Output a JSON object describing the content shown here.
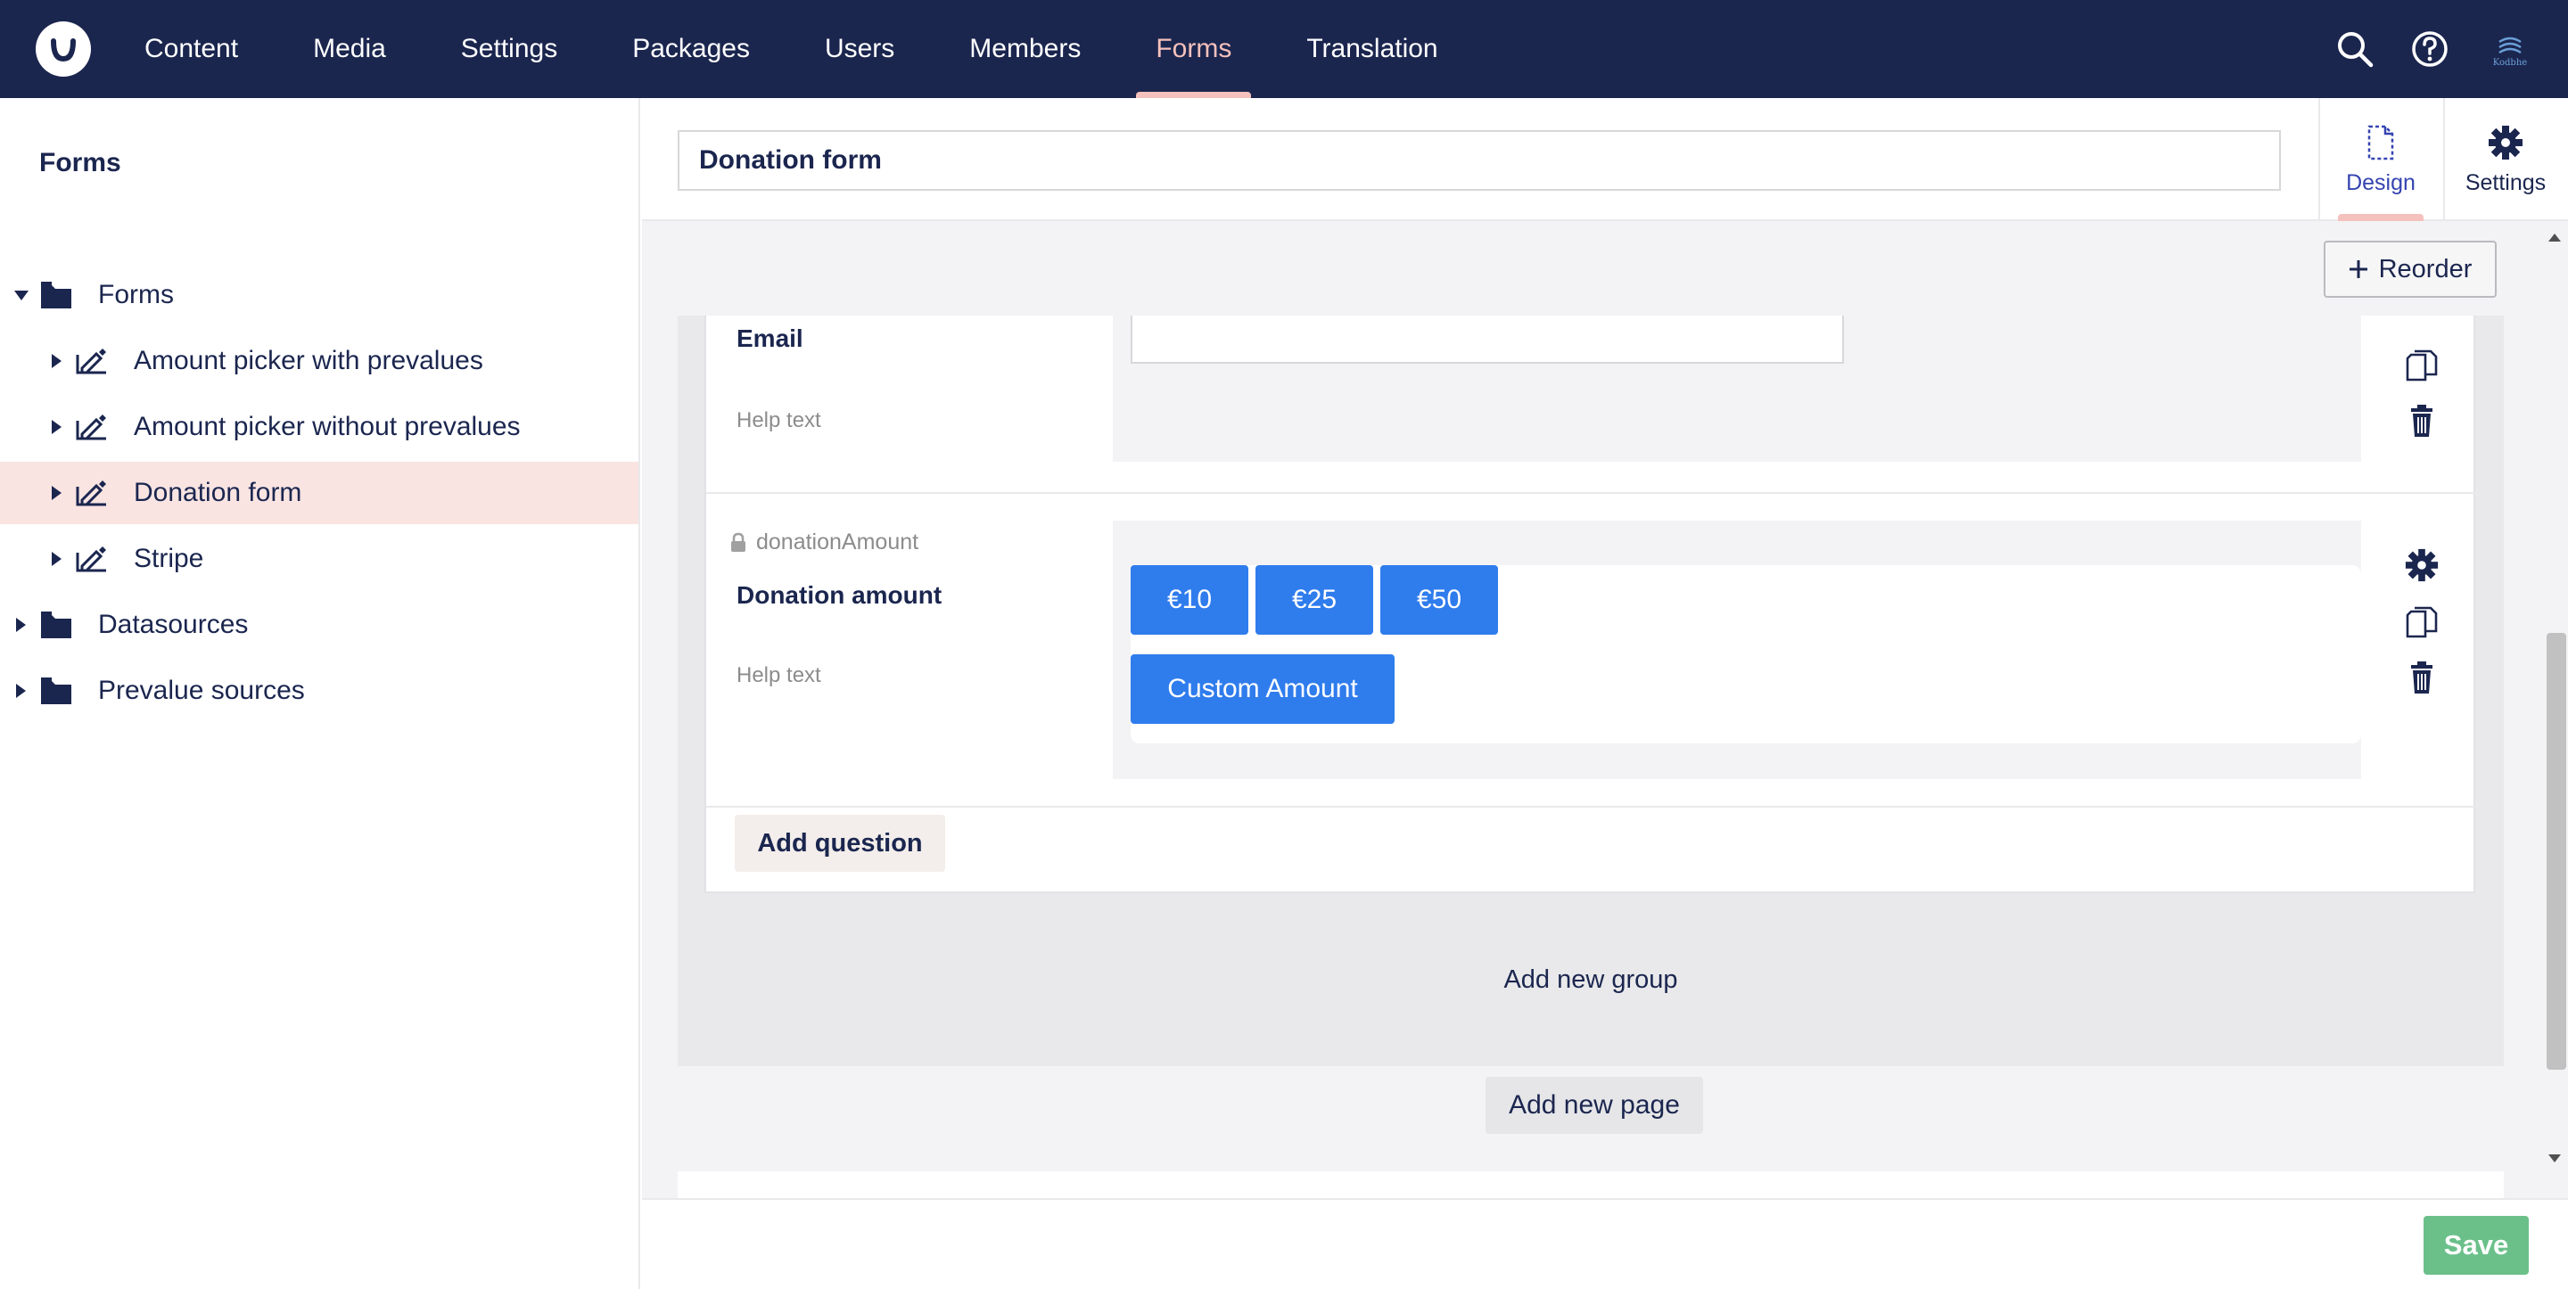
{
  "nav": {
    "items": [
      {
        "label": "Content"
      },
      {
        "label": "Media"
      },
      {
        "label": "Settings"
      },
      {
        "label": "Packages"
      },
      {
        "label": "Users"
      },
      {
        "label": "Members"
      },
      {
        "label": "Forms",
        "active": true
      },
      {
        "label": "Translation"
      }
    ],
    "avatar_text": "Kodbhe"
  },
  "sidebar": {
    "title": "Forms",
    "tree": [
      {
        "label": "Forms",
        "icon": "folder-icon",
        "expanded": true
      },
      {
        "label": "Amount picker with prevalues",
        "icon": "form-edit-icon"
      },
      {
        "label": "Amount picker without prevalues",
        "icon": "form-edit-icon"
      },
      {
        "label": "Donation form",
        "icon": "form-edit-icon",
        "selected": true
      },
      {
        "label": "Stripe",
        "icon": "form-edit-icon"
      },
      {
        "label": "Datasources",
        "icon": "folder-icon"
      },
      {
        "label": "Prevalue sources",
        "icon": "folder-icon"
      }
    ]
  },
  "editor": {
    "form_name": "Donation form",
    "apps": [
      {
        "label": "Design",
        "active": true
      },
      {
        "label": "Settings"
      }
    ],
    "reorder_label": "Reorder",
    "fields": [
      {
        "label": "Email",
        "help_text": "Help text"
      },
      {
        "alias": "donationAmount",
        "label": "Donation amount",
        "help_text": "Help text",
        "amounts": [
          "€10",
          "€25",
          "€50"
        ],
        "custom_amount_label": "Custom Amount"
      }
    ],
    "add_question_label": "Add question",
    "add_group_label": "Add new group",
    "add_page_label": "Add new page"
  },
  "footer": {
    "save_label": "Save",
    "save_color": "#6bc08a"
  },
  "colors": {
    "header_bg": "#1b264f",
    "active_accent": "#f5c1bc",
    "amount_button": "#2f7ced"
  }
}
